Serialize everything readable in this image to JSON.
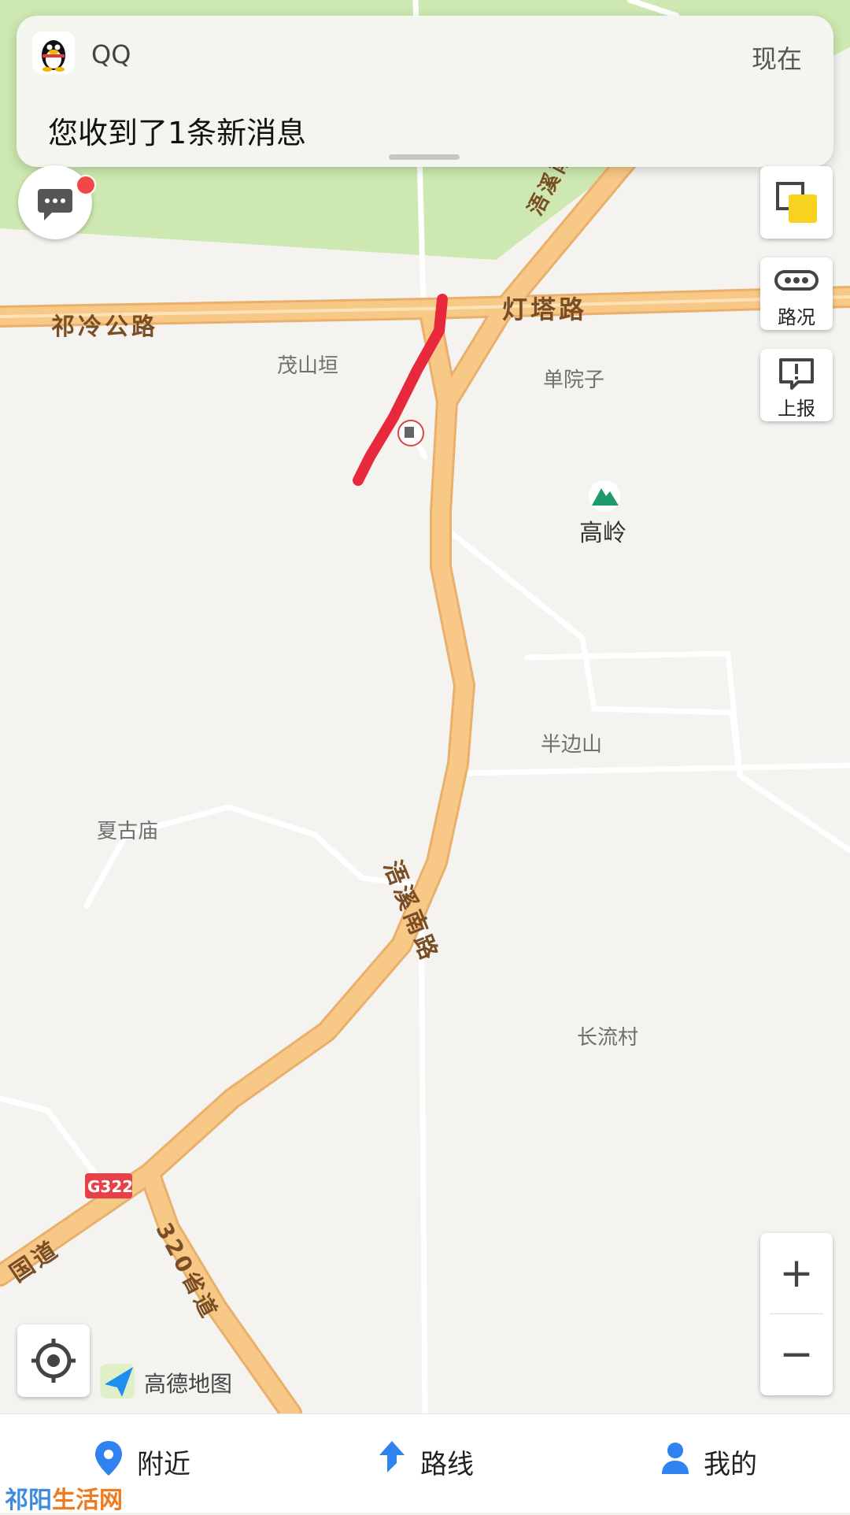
{
  "notification": {
    "app_name": "QQ",
    "time": "现在",
    "message": "您收到了1条新消息",
    "icon": "qq-penguin-icon"
  },
  "map": {
    "roads": {
      "qiling": "祁冷公路",
      "dengta": "灯塔路",
      "wuxi_north": "浯溪南路",
      "wuxi_south": "浯溪南路",
      "g322_badge": "G322",
      "guodao": "国道",
      "shengdao": "320省道"
    },
    "places": {
      "maoshanyuan": "茂山垣",
      "danyuanzi": "单院子",
      "gaoling": "高岭",
      "banbianshan": "半边山",
      "xiagumiao": "夏古庙",
      "changliucun": "长流村"
    },
    "colors": {
      "road": "#f8c887",
      "park": "#cde8b0",
      "background": "#f4f3ef",
      "annotation": "#e8283c"
    }
  },
  "controls": {
    "traffic_label": "路况",
    "report_label": "上报",
    "zoom_in": "+",
    "zoom_out": "−",
    "brand": "高德地图"
  },
  "tabs": {
    "nearby": "附近",
    "route": "路线",
    "mine": "我的"
  },
  "watermark": {
    "part1": "祁阳",
    "part2": "生活网"
  }
}
